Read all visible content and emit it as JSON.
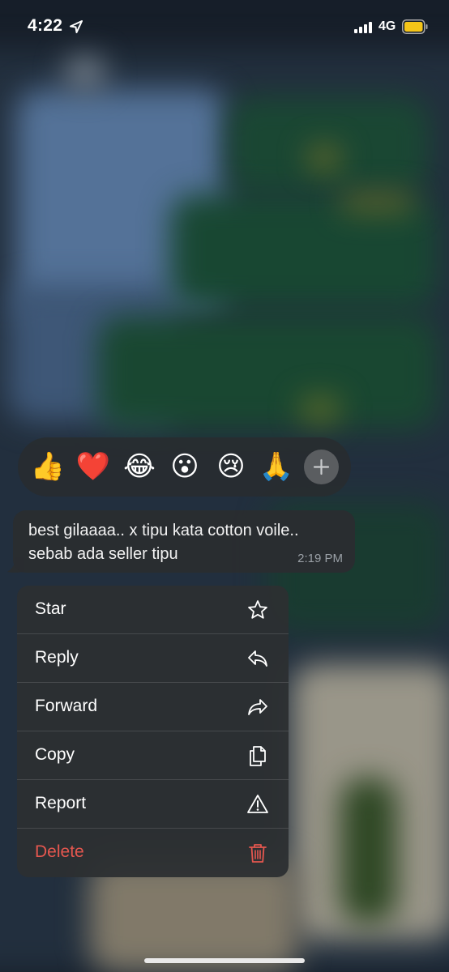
{
  "status_bar": {
    "time": "4:22",
    "network": "4G",
    "icons": [
      "location-arrow-icon",
      "signal-bars-icon",
      "battery-icon"
    ],
    "battery_color": "#f5c518"
  },
  "reactions": {
    "items": [
      {
        "name": "thumbs-up-emoji",
        "glyph": "👍"
      },
      {
        "name": "heart-emoji",
        "glyph": "❤️"
      },
      {
        "name": "tears-of-joy-emoji",
        "glyph": "😂"
      },
      {
        "name": "surprised-emoji",
        "glyph": "😮"
      },
      {
        "name": "crying-emoji",
        "glyph": "😢"
      },
      {
        "name": "folded-hands-emoji",
        "glyph": "🙏"
      }
    ],
    "more_icon": "plus-icon"
  },
  "message": {
    "text": "best gilaaaa.. x tipu kata cotton voile.. sebab ada seller tipu",
    "time": "2:19 PM"
  },
  "menu": {
    "items": [
      {
        "label": "Star",
        "icon": "star-icon"
      },
      {
        "label": "Reply",
        "icon": "reply-icon"
      },
      {
        "label": "Forward",
        "icon": "forward-icon"
      },
      {
        "label": "Copy",
        "icon": "copy-icon"
      },
      {
        "label": "Report",
        "icon": "warning-icon"
      },
      {
        "label": "Delete",
        "icon": "trash-icon"
      }
    ],
    "delete_color": "#e5574f"
  }
}
